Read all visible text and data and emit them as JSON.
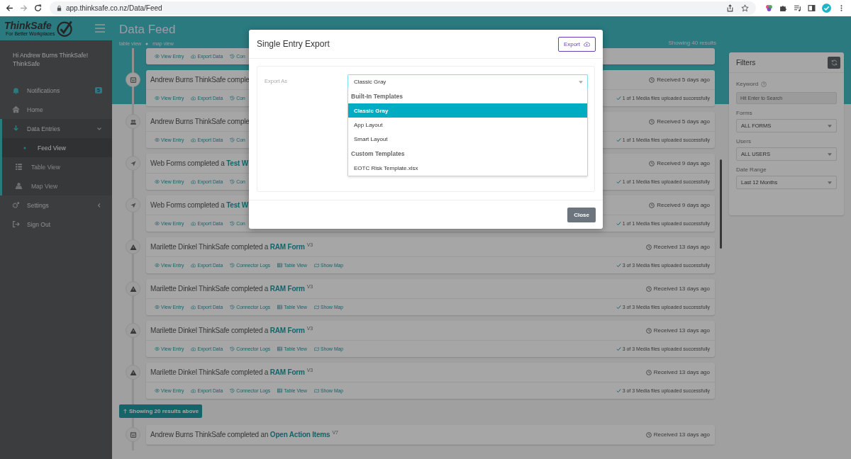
{
  "browser": {
    "url": "app.thinksafe.co.nz/Data/Feed"
  },
  "sidebar": {
    "logo": {
      "name": "ThinkSafe",
      "tagline": "For Better Workplaces"
    },
    "greeting": "Hi Andrew Burns ThinkSafe!",
    "organisation": "ThinkSafe",
    "nav": [
      {
        "label": "Notifications",
        "badge": "5",
        "selected": false
      },
      {
        "label": "Home",
        "selected": false
      },
      {
        "label": "Data Entries",
        "selected": true,
        "expanded": true,
        "children": [
          {
            "label": "Feed View",
            "selected": true
          },
          {
            "label": "Table View",
            "selected": false
          },
          {
            "label": "Map View",
            "selected": false
          }
        ]
      },
      {
        "label": "Settings",
        "selected": false,
        "expanded": false
      },
      {
        "label": "Sign Out",
        "selected": false
      }
    ]
  },
  "header": {
    "title": "Data Feed",
    "links": [
      "table view",
      "map view"
    ],
    "results": "Showing 40 results"
  },
  "feed": {
    "cards": [
      {
        "actions": [
          "View Entry",
          "Export Data",
          "Con"
        ]
      },
      {
        "title": {
          "text": "Andrew Burns ThinkSafe comple"
        },
        "received": "Received 5 days ago",
        "actions": [
          "View Entry",
          "Export Data",
          "Con"
        ],
        "media": "1 of 1 Media files uploaded successfully"
      },
      {
        "title": {
          "text": "Andrew Burns ThinkSafe comple"
        },
        "received": "Received 5 days ago",
        "actions": [
          "View Entry",
          "Export Data",
          "Con"
        ],
        "media": "1 of 1 Media files uploaded successfully"
      },
      {
        "title": {
          "text": "Web Forms completed a ",
          "form": "Test W"
        },
        "received": "Received 9 days ago",
        "actions": [
          "View Entry",
          "Export Data",
          "Con"
        ],
        "media": "1 of 1 Media files uploaded successfully"
      },
      {
        "title": {
          "text": "Web Forms completed a ",
          "form": "Test W"
        },
        "received": "Received 9 days ago",
        "actions": [
          "View Entry",
          "Export Data",
          "Con"
        ],
        "media": "1 of 1 Media files uploaded successfully"
      },
      {
        "title": {
          "text": "Marilette Dinkel ThinkSafe completed a ",
          "form": "RAM Form",
          "version": "V3"
        },
        "received": "Received 13 days ago",
        "actions": [
          "View Entry",
          "Export Data",
          "Connector Logs",
          "Table View",
          "Show Map"
        ],
        "media": "3 of 3 Media files uploaded successfully"
      },
      {
        "title": {
          "text": "Marilette Dinkel ThinkSafe completed a ",
          "form": "RAM Form",
          "version": "V3"
        },
        "received": "Received 13 days ago",
        "actions": [
          "View Entry",
          "Export Data",
          "Connector Logs",
          "Table View",
          "Show Map"
        ],
        "media": "3 of 3 Media files uploaded successfully"
      },
      {
        "title": {
          "text": "Marilette Dinkel ThinkSafe completed a ",
          "form": "RAM Form",
          "version": "V3"
        },
        "received": "Received 13 days ago",
        "actions": [
          "View Entry",
          "Export Data",
          "Connector Logs",
          "Table View",
          "Show Map"
        ],
        "media": "3 of 3 Media files uploaded successfully"
      },
      {
        "title": {
          "text": "Marilette Dinkel ThinkSafe completed a ",
          "form": "RAM Form",
          "version": "V3"
        },
        "received": "Received 13 days ago",
        "actions": [
          "View Entry",
          "Export Data",
          "Connector Logs",
          "Table View",
          "Show Map"
        ],
        "media": "3 of 3 Media files uploaded successfully"
      }
    ],
    "more_button": "Showing 20 results above",
    "later_cards": [
      {
        "title": {
          "text": "Andrew Burns ThinkSafe completed an ",
          "form": "Open Action Items",
          "version": "V7"
        },
        "received": "Received 13 days ago"
      }
    ]
  },
  "filters": {
    "title": "Filters",
    "fields": [
      {
        "kind": "text",
        "label": "Keyword",
        "help": true,
        "placeholder": "Hit Enter to Search"
      },
      {
        "kind": "select",
        "label": "Forms",
        "value": "ALL FORMS"
      },
      {
        "kind": "select",
        "label": "Users",
        "value": "ALL USERS"
      },
      {
        "kind": "select",
        "label": "Date Range",
        "value": "Last 12 Months"
      }
    ]
  },
  "modal": {
    "title": "Single Entry Export",
    "export_button": "Export",
    "field_label": "Export As",
    "select_value": "Classic Gray",
    "dropdown": [
      {
        "group": "Built-In Templates",
        "options": [
          {
            "label": "Classic Gray",
            "selected": true
          },
          {
            "label": "App Layout",
            "selected": false
          },
          {
            "label": "Smart Layout",
            "selected": false
          }
        ]
      },
      {
        "group": "Custom Templates",
        "options": [
          {
            "label": "EOTC Risk Template.xlsx",
            "selected": false
          }
        ]
      }
    ],
    "close_button": "Close"
  }
}
